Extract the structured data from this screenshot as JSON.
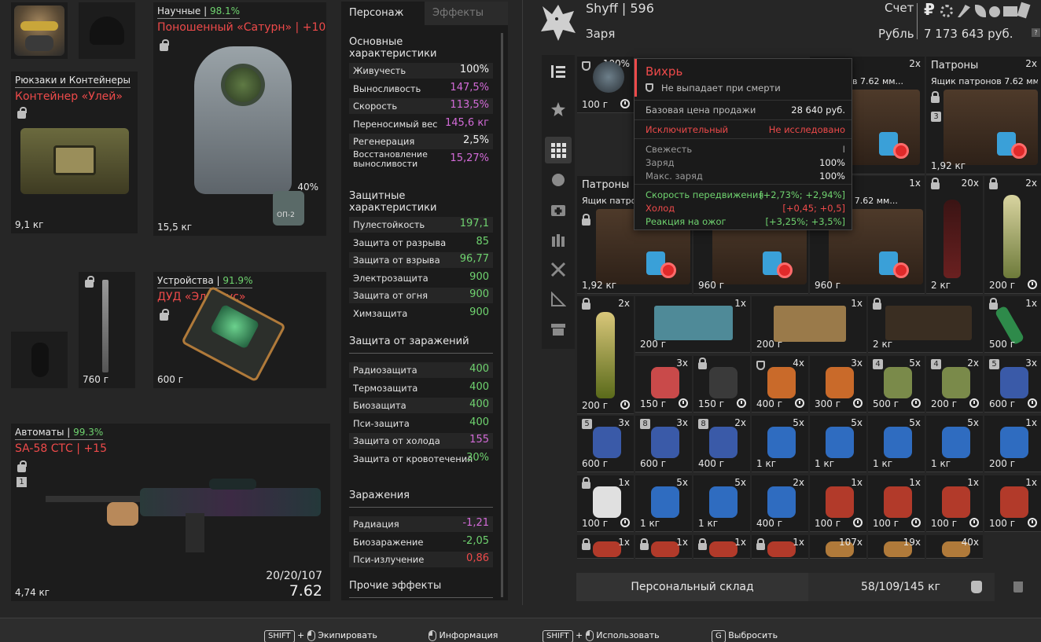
{
  "equipment": {
    "helmet": {
      "level": "98.1%"
    },
    "armor": {
      "category": "Научные",
      "condition": "98.1%",
      "name": "Поношенный «Сатурн» | +10",
      "weight": "15,5 кг",
      "container_charge": "40%",
      "container_label": "ОП-2"
    },
    "backpack": {
      "category": "Рюкзаки и Контейнеры",
      "name": "Контейнер «Улей»",
      "weight": "9,1 кг"
    },
    "melee": {
      "weight": "760 г"
    },
    "device": {
      "category": "Устройства",
      "condition": "91.9%",
      "name": "ДУД «Эльбрус»",
      "weight": "600 г"
    },
    "weapon": {
      "category": "Автоматы",
      "condition": "99.3%",
      "name": "SA-58 СТС | +15",
      "slot_number": "1",
      "weight": "4,74 кг",
      "ammo": "20/20/107",
      "caliber": "7.62"
    }
  },
  "stats_panel": {
    "tabs": [
      "Персонаж",
      "Эффекты"
    ],
    "sections": [
      {
        "title": "Основные характеристики",
        "rows": [
          {
            "label": "Живучесть",
            "value": "100%",
            "color": "white"
          },
          {
            "label": "Выносливость",
            "value": "147,5%",
            "color": "purple"
          },
          {
            "label": "Скорость",
            "value": "113,5%",
            "color": "purple"
          },
          {
            "label": "Переносимый вес",
            "value": "145,6 кг",
            "color": "purple"
          },
          {
            "label": "Регенерация",
            "value": "2,5%",
            "color": "white"
          },
          {
            "label": "Восстановление выносливости",
            "value": "15,27%",
            "color": "purple"
          }
        ]
      },
      {
        "title": "Защитные характеристики",
        "rows": [
          {
            "label": "Пулестойкость",
            "value": "197,1",
            "color": "green"
          },
          {
            "label": "Защита от разрыва",
            "value": "85",
            "color": "green"
          },
          {
            "label": "Защита от взрыва",
            "value": "96,77",
            "color": "green"
          },
          {
            "label": "Электрозащита",
            "value": "900",
            "color": "green"
          },
          {
            "label": "Защита от огня",
            "value": "900",
            "color": "green"
          },
          {
            "label": "Химзащита",
            "value": "900",
            "color": "green"
          }
        ]
      },
      {
        "title": "Защита от заражений",
        "rows": [
          {
            "label": "Радиозащита",
            "value": "400",
            "color": "green"
          },
          {
            "label": "Термозащита",
            "value": "400",
            "color": "green"
          },
          {
            "label": "Биозащита",
            "value": "400",
            "color": "green"
          },
          {
            "label": "Пси-защита",
            "value": "400",
            "color": "green"
          },
          {
            "label": "Защита от холода",
            "value": "155",
            "color": "purple"
          },
          {
            "label": "Защита от кровотечения",
            "value": "30%",
            "color": "green"
          }
        ]
      },
      {
        "title": "Заражения",
        "rows": [
          {
            "label": "Радиация",
            "value": "-1,21",
            "color": "purple"
          },
          {
            "label": "Биозаражение",
            "value": "-2,05",
            "color": "green"
          },
          {
            "label": "Пси-излучение",
            "value": "0,86",
            "color": "red"
          }
        ]
      },
      {
        "title": "Прочие эффекты",
        "rows": []
      }
    ]
  },
  "header": {
    "player": "Shyff | 596",
    "faction": "Заря",
    "account_label": "Счет",
    "currency_label": "Рубль",
    "money": "7 173 643 руб.",
    "help": "?"
  },
  "tooltip": {
    "name": "Вихрь",
    "no_drop": "Не выпадает при смерти",
    "base_price_label": "Базовая цена продажи",
    "base_price": "28 640 руб.",
    "rarity": "Исключительный",
    "research": "Не исследовано",
    "freshness_label": "Свежесть",
    "freshness": "I",
    "charge_label": "Заряд",
    "charge": "100%",
    "max_charge_label": "Макс. заряд",
    "max_charge": "100%",
    "effects": [
      {
        "label": "Скорость передвижения",
        "value": "[+2,73%; +2,94%]",
        "color": "green"
      },
      {
        "label": "Холод",
        "value": "[+0,45; +0,5]",
        "color": "red"
      },
      {
        "label": "Реакция на ожог",
        "value": "[+3,25%; +3,5%]",
        "color": "green"
      }
    ]
  },
  "storage": {
    "label": "Персональный склад",
    "weight": "58/109/145 кг"
  },
  "grid_cells": {
    "c1": {
      "count": "100%",
      "weight": "100 г"
    },
    "c2": {
      "count": "2x",
      "title": "патронов 7.62 мм..."
    },
    "c3": {
      "category": "Патроны",
      "count": "2x",
      "title": "Ящик патронов 7.62 мм...",
      "level": "3",
      "weight": "1,92 кг"
    },
    "c4": {
      "category": "Патроны",
      "title": "Ящик патро",
      "weight": "1,92 кг"
    },
    "c5": {
      "weight": "960 г"
    },
    "c6": {
      "count": "1x",
      "title": "атронов 7.62 мм...",
      "weight": "960 г"
    },
    "c7": {
      "count": "20x",
      "weight": "2 кг"
    },
    "c8": {
      "count": "2x",
      "weight": "200 г"
    },
    "r3": [
      {
        "count": "2x",
        "weight": "200 г"
      },
      {
        "count": "1x",
        "weight": "200 г"
      },
      {
        "count": "1x",
        "weight": "200 г"
      },
      {
        "count": "",
        "weight": "2 кг"
      },
      {
        "count": "1x",
        "weight": "500 г"
      }
    ],
    "r4": [
      {
        "count": "3x",
        "weight": "150 г"
      },
      {
        "count": "",
        "weight": "150 г"
      },
      {
        "count": "4x",
        "weight": "400 г"
      },
      {
        "count": "3x",
        "weight": "300 г"
      },
      {
        "count": "5x",
        "level": "4",
        "weight": "500 г"
      },
      {
        "count": "2x",
        "level": "4",
        "weight": "200 г"
      },
      {
        "count": "3x",
        "level": "5",
        "weight": "600 г"
      }
    ],
    "r5": [
      {
        "count": "3x",
        "level": "5",
        "weight": "600 г"
      },
      {
        "count": "3x",
        "level": "8",
        "weight": "600 г"
      },
      {
        "count": "2x",
        "level": "8",
        "weight": "400 г"
      },
      {
        "count": "5x",
        "weight": "1 кг"
      },
      {
        "count": "5x",
        "weight": "1 кг"
      },
      {
        "count": "5x",
        "weight": "1 кг"
      },
      {
        "count": "5x",
        "weight": "1 кг"
      },
      {
        "count": "1x",
        "weight": "200 г"
      }
    ],
    "r6": [
      {
        "count": "1x",
        "weight": "100 г"
      },
      {
        "count": "5x",
        "weight": "1 кг"
      },
      {
        "count": "5x",
        "weight": "1 кг"
      },
      {
        "count": "2x",
        "weight": "400 г"
      },
      {
        "count": "1x",
        "weight": "100 г"
      },
      {
        "count": "1x",
        "weight": "100 г"
      },
      {
        "count": "1x",
        "weight": "100 г"
      },
      {
        "count": "1x",
        "weight": "100 г"
      }
    ],
    "r7": [
      {
        "count": "1x"
      },
      {
        "count": "1x"
      },
      {
        "count": "1x"
      },
      {
        "count": "1x"
      },
      {
        "count": "107x"
      },
      {
        "count": "19x"
      },
      {
        "count": "40x"
      }
    ]
  },
  "hints": [
    {
      "key": "SHIFT",
      "plus": "+",
      "action": "Экипировать"
    },
    {
      "action": "Информация"
    },
    {
      "key": "SHIFT",
      "plus": "+",
      "action": "Использовать"
    },
    {
      "key": "G",
      "action": "Выбросить"
    }
  ],
  "colors": {
    "accent_red": "#ee4a4a",
    "green": "#6fd36f",
    "purple": "#d36bd8",
    "panel": "#1b1b1b",
    "bg": "#262626"
  }
}
